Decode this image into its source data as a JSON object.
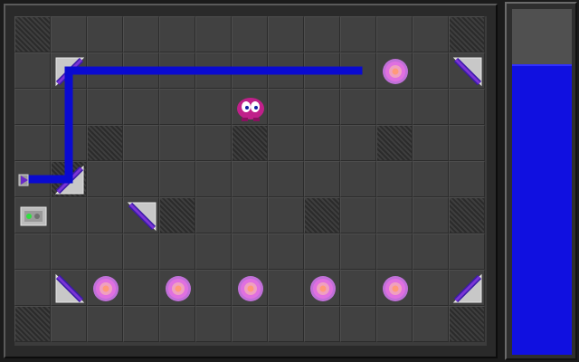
{
  "game": {
    "board": {
      "cols": 13,
      "rows": 9,
      "walls": [
        [
          0,
          0
        ],
        [
          12,
          0
        ],
        [
          2,
          3
        ],
        [
          6,
          3
        ],
        [
          10,
          3
        ],
        [
          1,
          4
        ],
        [
          4,
          5
        ],
        [
          8,
          5
        ],
        [
          12,
          5
        ],
        [
          0,
          8
        ],
        [
          12,
          8
        ]
      ],
      "pieces": [
        {
          "type": "mirror",
          "col": 1,
          "row": 1,
          "orient": "tl"
        },
        {
          "type": "mirror",
          "col": 12,
          "row": 1,
          "orient": "tr"
        },
        {
          "type": "mirror",
          "col": 1,
          "row": 4,
          "orient": "br"
        },
        {
          "type": "mirror",
          "col": 3,
          "row": 5,
          "orient": "tr"
        },
        {
          "type": "mirror",
          "col": 1,
          "row": 7,
          "orient": "bl"
        },
        {
          "type": "mirror",
          "col": 12,
          "row": 7,
          "orient": "br"
        },
        {
          "type": "kettle",
          "col": 10,
          "row": 1
        },
        {
          "type": "kettle",
          "col": 2,
          "row": 7
        },
        {
          "type": "kettle",
          "col": 4,
          "row": 7
        },
        {
          "type": "kettle",
          "col": 6,
          "row": 7
        },
        {
          "type": "kettle",
          "col": 8,
          "row": 7
        },
        {
          "type": "kettle",
          "col": 10,
          "row": 7
        },
        {
          "type": "laser-cannon",
          "col": 0,
          "row": 4
        },
        {
          "type": "receiver",
          "col": 0,
          "row": 5
        },
        {
          "type": "player",
          "col": 6,
          "row": 2
        }
      ],
      "beam_path": [
        [
          0,
          4
        ],
        [
          1,
          4
        ],
        [
          1,
          1
        ],
        [
          9,
          1
        ]
      ]
    },
    "colors": {
      "beam": "#0a0ad0",
      "energy": "#1010e0",
      "kettle": "#e070e0",
      "player": "#c0208a",
      "mirror": "#7b34d6"
    },
    "energy_level": 0.84
  }
}
